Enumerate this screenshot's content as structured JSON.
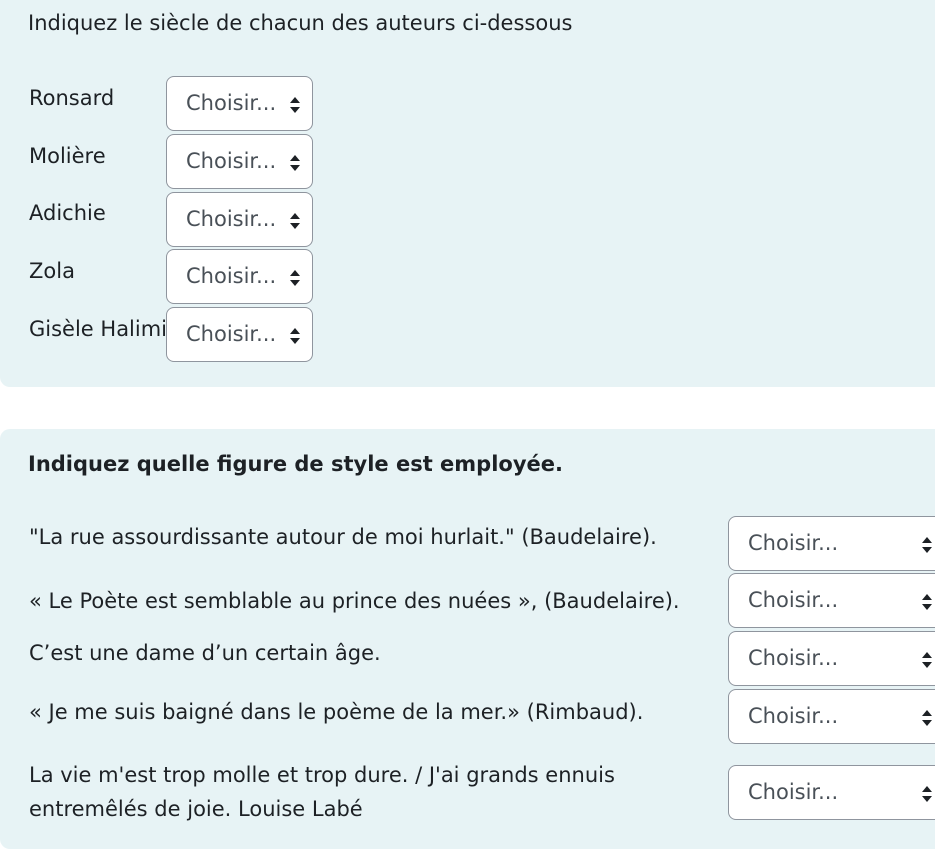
{
  "question1": {
    "prompt": "Indiquez le siècle de chacun des auteurs ci-dessous",
    "items": [
      {
        "label": "Ronsard",
        "selected": "Choisir..."
      },
      {
        "label": "Molière",
        "selected": "Choisir..."
      },
      {
        "label": "Adichie",
        "selected": "Choisir..."
      },
      {
        "label": "Zola",
        "selected": "Choisir..."
      },
      {
        "label": "Gisèle Halimi",
        "selected": "Choisir..."
      }
    ]
  },
  "question2": {
    "prompt": "Indiquez quelle figure de style est employée.",
    "items": [
      {
        "label": "\"La rue assourdissante autour de moi hurlait.\" (Baudelaire).",
        "selected": "Choisir..."
      },
      {
        "label": "« Le Poète est semblable au prince des nuées », (Baudelaire).",
        "selected": "Choisir..."
      },
      {
        "label": "C’est une dame d’un certain âge.",
        "selected": "Choisir..."
      },
      {
        "label": "« Je me suis baigné dans le poème de la mer.» (Rimbaud).",
        "selected": "Choisir..."
      },
      {
        "label": "La vie m'est trop molle et trop dure. / J'ai grands ennuis entremêlés de joie. Louise Labé",
        "selected": "Choisir..."
      }
    ]
  },
  "colors": {
    "panel_bg": "#e7f3f5",
    "select_border": "#8f959e",
    "text": "#1d2125"
  }
}
